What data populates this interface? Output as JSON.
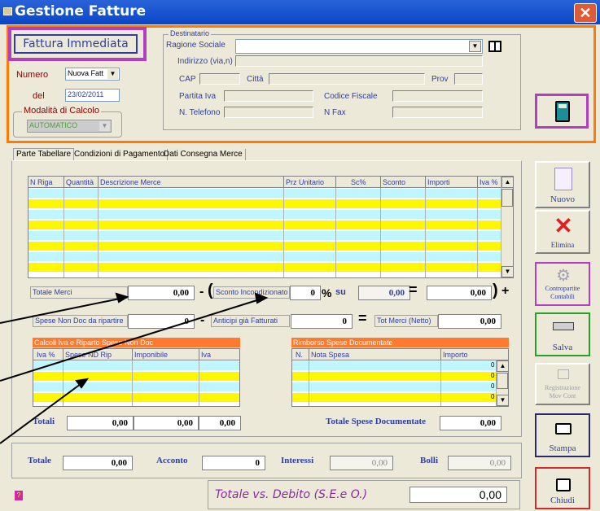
{
  "window": {
    "title": "Gestione Fatture",
    "close": "✕"
  },
  "header": {
    "fattura_type": "Fattura Immediata",
    "numero_label": "Numero",
    "numero_value": "Nuova Fatt",
    "del_label": "del",
    "del_value": "23/02/2011",
    "modalita_label": "Modalità di Calcolo",
    "modalita_value": "AUTOMATICO"
  },
  "destinatario": {
    "legend": "Destinatario",
    "ragione_sociale": "Ragione Sociale",
    "indirizzo": "Indirizzo (via,n)",
    "cap": "CAP",
    "citta": "Città",
    "prov": "Prov",
    "partita_iva": "Partita Iva",
    "codice_fiscale": "Codice Fiscale",
    "telefono": "N. Telefono",
    "fax": "N Fax"
  },
  "tabs": [
    "Parte Tabellare",
    "Condizioni di Pagamento",
    "Dati Consegna Merce"
  ],
  "main_grid": {
    "headers": [
      "N Riga",
      "Quantità",
      "Descrizione Merce",
      "Prz Unitario",
      "Sc%",
      "Sconto",
      "Importi",
      "Iva %"
    ]
  },
  "totals": {
    "totale_merci_label": "Totale Merci",
    "totale_merci": "0,00",
    "minus1": "-",
    "open_paren": "(",
    "sconto_incond_label": "Sconto Incondizionato",
    "sconto_pct": "0",
    "pct": "%",
    "su": "su",
    "su_value": "0,00",
    "equals1": "=",
    "sconto_result": "0,00",
    "close_paren": ")",
    "plus": "+",
    "spese_label": "Spese Non Doc da ripartire",
    "spese_value": "0",
    "minus2": "-",
    "anticipi_label": "Anticipi già Fatturati",
    "anticipi_value": "0",
    "equals2": "=",
    "tot_merci_netto_label": "Tot Merci (Netto)",
    "tot_merci_netto": "0,00"
  },
  "iva_panel": {
    "title": "Calcoli Iva e Riparto Spese Non Doc",
    "headers": [
      "Iva %",
      "Spese ND Rip",
      "Imponibile",
      "Iva"
    ],
    "totali_label": "Totali",
    "totali": [
      "0,00",
      "0,00",
      "0,00"
    ]
  },
  "rimborso_panel": {
    "title": "Rimborso Spese Documentate",
    "headers": [
      "N.",
      "Nota Spesa",
      "Importo"
    ],
    "cell_values": [
      "0",
      "0",
      "0",
      "0"
    ],
    "totale_label": "Totale Spese Documentate",
    "totale": "0,00"
  },
  "footer": {
    "totale_label": "Totale",
    "totale": "0,00",
    "acconto_label": "Acconto",
    "acconto": "0",
    "interessi_label": "Interessi",
    "interessi": "0,00",
    "bolli_label": "Bolli",
    "bolli": "0,00",
    "debito_label": "Totale vs. Debito (S.E.e O.)",
    "debito": "0,00",
    "help": "?"
  },
  "side_buttons": [
    "Nuovo",
    "Elimina",
    "Contropartite Contabili",
    "Salva",
    "Registrazione Mov Cont",
    "Stampa",
    "Chiudi"
  ],
  "colors": {
    "highlight_purple": "#b040c0",
    "highlight_orange": "#ff7a00",
    "row_yellow": "#fff700",
    "row_cyan": "#bff6ff",
    "panel_header": "#ff7a30"
  }
}
